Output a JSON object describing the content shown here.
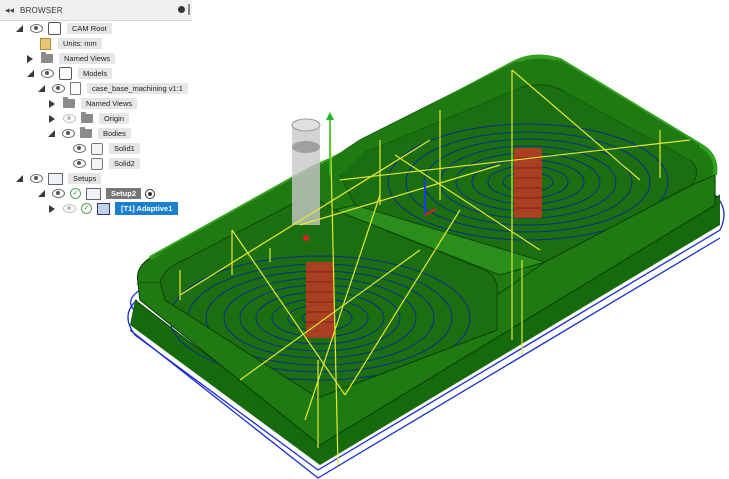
{
  "browser": {
    "title": "BROWSER",
    "items": {
      "cam_root": "CAM Root",
      "units": "Units: mm",
      "named_views": "Named Views",
      "models": "Models",
      "model_file": "case_base_machining v1:1",
      "model_named_views": "Named Views",
      "origin": "Origin",
      "bodies": "Bodies",
      "solid1": "Solid1",
      "solid2": "Solid2",
      "setups": "Setups",
      "setup2": "Setup2",
      "operation": "[T1] Adaptive1"
    }
  },
  "colors": {
    "part_green": "#1f7a12",
    "toolpath_blue": "#1730c8",
    "link_yellow": "#e6e832",
    "plunge_red": "#c23a22",
    "selected_blue": "#1a7fd1"
  }
}
